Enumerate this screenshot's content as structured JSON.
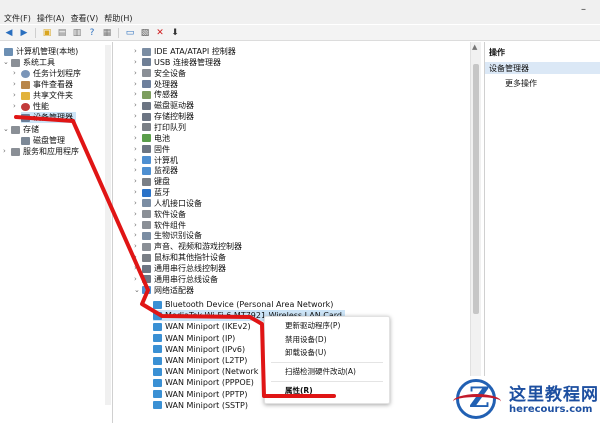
{
  "menubar": [
    "文件(F)",
    "操作(A)",
    "查看(V)",
    "帮助(H)"
  ],
  "window_controls": [
    "–"
  ],
  "left_tree": {
    "root": "计算机管理(本地)",
    "system_tools": "系统工具",
    "children": [
      "任务计划程序",
      "事件查看器",
      "共享文件夹",
      "性能",
      "设备管理器"
    ],
    "storage": "存储",
    "disk": "磁盘管理",
    "services": "服务和应用程序"
  },
  "device_categories": [
    "IDE ATA/ATAPI 控制器",
    "USB 连接器管理器",
    "安全设备",
    "处理器",
    "传感器",
    "磁盘驱动器",
    "存储控制器",
    "打印队列",
    "电池",
    "固件",
    "计算机",
    "监视器",
    "键盘",
    "蓝牙",
    "人机接口设备",
    "软件设备",
    "软件组件",
    "生物识别设备",
    "声音、视频和游戏控制器",
    "鼠标和其他指针设备",
    "通用串行总线控制器",
    "通用串行总线设备",
    "网络适配器"
  ],
  "network_children": [
    "Bluetooth Device (Personal Area Network)",
    "MediaTek Wi-Fi 6 MT7921 Wireless LAN Card",
    "WAN Miniport (IKEv2)",
    "WAN Miniport (IP)",
    "WAN Miniport (IPv6)",
    "WAN Miniport (L2TP)",
    "WAN Miniport (Network Mo",
    "WAN Miniport (PPPOE)",
    "WAN Miniport (PPTP)",
    "WAN Miniport (SSTP)"
  ],
  "context_menu": [
    "更新驱动程序(P)",
    "禁用设备(D)",
    "卸载设备(U)",
    "扫描检测硬件改动(A)",
    "属性(R)"
  ],
  "actions": {
    "header": "操作",
    "sub": "设备管理器",
    "more": "更多操作"
  },
  "watermark": {
    "name": "这里教程网",
    "url": "herecours.com"
  },
  "colors": {
    "annotation": "#e01515",
    "selected": "#cce4f7",
    "action_header": "#dbe8f6",
    "logo_blue": "#1d4fa0",
    "logo_red": "#c21a2b"
  }
}
